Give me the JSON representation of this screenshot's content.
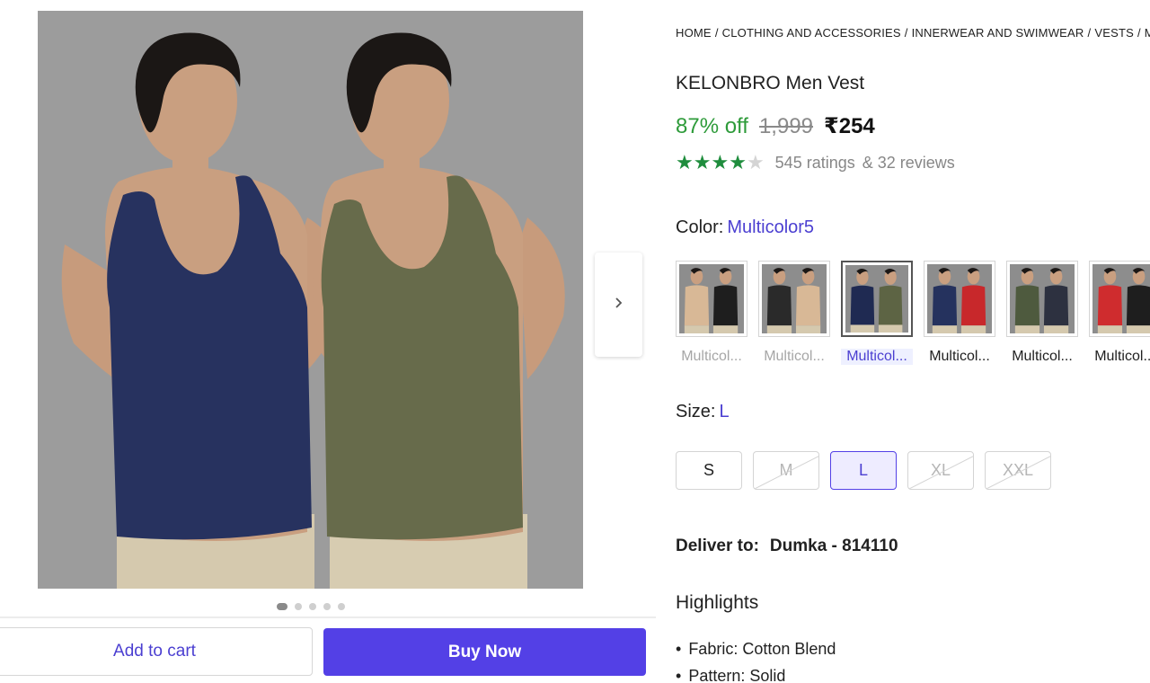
{
  "breadcrumb": [
    "HOME",
    "CLOTHING AND ACCESSORIES",
    "INNERWEAR AND SWIMWEAR",
    "VESTS",
    "M"
  ],
  "product": {
    "title": "KELONBRO Men Vest",
    "discount": "87% off",
    "mrp": "1,999",
    "price": "₹254",
    "rating_stars": 4,
    "ratings_text": "545 ratings",
    "reviews_text": "& 32 reviews"
  },
  "color": {
    "label": "Color:",
    "selected": "Multicolor5",
    "options": [
      {
        "name": "Multicol...",
        "status": "out-of-stock",
        "colors": [
          "#d8b896",
          "#1e1e1e"
        ]
      },
      {
        "name": "Multicol...",
        "status": "out-of-stock",
        "colors": [
          "#2a2a2a",
          "#d8b896"
        ]
      },
      {
        "name": "Multicol...",
        "status": "selected",
        "colors": [
          "#1f2a52",
          "#5d6444"
        ]
      },
      {
        "name": "Multicol...",
        "status": "available",
        "colors": [
          "#25325e",
          "#c8282b"
        ]
      },
      {
        "name": "Multicol...",
        "status": "available",
        "colors": [
          "#4e5a3e",
          "#2d3140"
        ]
      },
      {
        "name": "Multicol...",
        "status": "available",
        "colors": [
          "#cf2c2e",
          "#1e1e1e"
        ]
      }
    ]
  },
  "size": {
    "label": "Size:",
    "selected": "L",
    "options": [
      {
        "label": "S",
        "status": "available"
      },
      {
        "label": "M",
        "status": "out-of-stock"
      },
      {
        "label": "L",
        "status": "selected"
      },
      {
        "label": "XL",
        "status": "out-of-stock"
      },
      {
        "label": "XXL",
        "status": "out-of-stock"
      }
    ]
  },
  "delivery": {
    "label": "Deliver to:",
    "location": "Dumka - 814110"
  },
  "highlights": {
    "title": "Highlights",
    "items": [
      "Fabric: Cotton Blend",
      "Pattern: Solid"
    ]
  },
  "actions": {
    "add_to_cart": "Add to cart",
    "buy_now": "Buy Now"
  },
  "gallery": {
    "image_count": 5,
    "active_index": 0
  },
  "icons": {
    "next": "chevron-right-icon",
    "star": "star-icon"
  },
  "colors": {
    "accent": "#5340e6",
    "discount_green": "#2e9b3a",
    "star_green": "#1f8d3d"
  }
}
